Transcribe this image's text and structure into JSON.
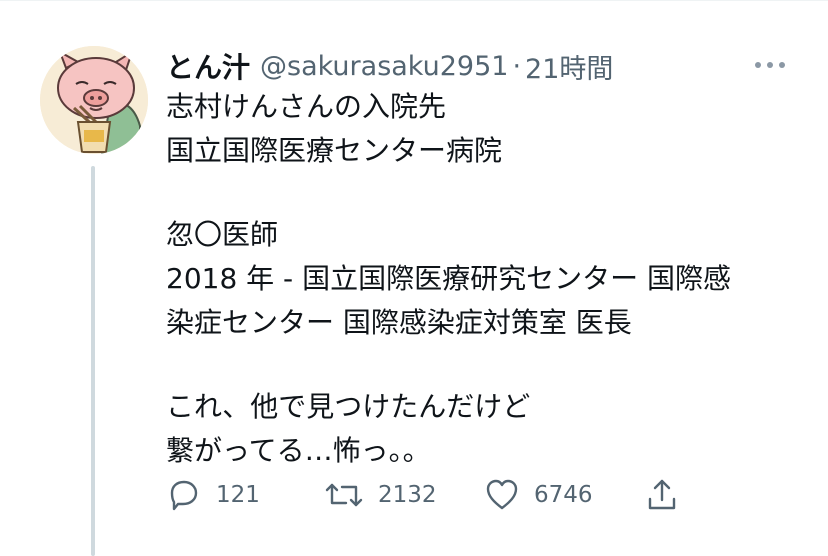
{
  "tweet": {
    "display_name": "とん汁",
    "handle": "@sakurasaku2951",
    "separator": "·",
    "time": "21時間",
    "lines": [
      "志村けんさんの入院先",
      "国立国際医療センター病院",
      "",
      "忽〇医師",
      "2018 年 - 国立国際医療研究センター 国際感",
      "染症センター 国際感染症対策室 医長",
      "",
      "これ、他で見つけたんだけど",
      "繋がってる…怖っ。。"
    ]
  },
  "actions": {
    "reply_count": "121",
    "retweet_count": "2132",
    "like_count": "6746"
  },
  "icons": {
    "more": "more-horizontal-icon",
    "reply": "speech-bubble-icon",
    "retweet": "retweet-arrows-icon",
    "like": "heart-icon",
    "share": "share-upload-icon"
  },
  "colors": {
    "text": "#0f1419",
    "secondary": "#536471",
    "thread_line": "#cfd9de",
    "avatar_background": "#f7ecd6"
  }
}
